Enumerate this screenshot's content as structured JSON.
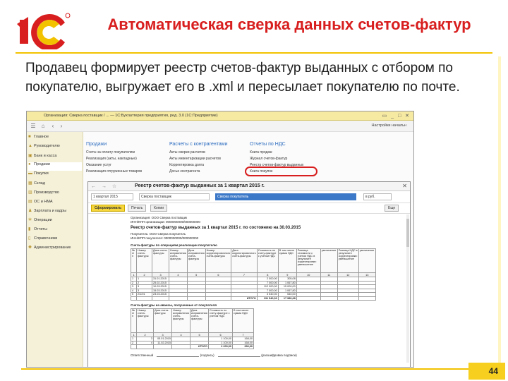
{
  "slide": {
    "title": "Автоматическая сверка данных счетов-фактур",
    "subtitle": "Продавец формирует реестр счетов-фактур выданных с отбором по покупателю, выгружает его в .xml и пересылает покупателю по почте.",
    "page_number": "44",
    "logo_text": "1С",
    "colors": {
      "accent": "#d81e1e",
      "brand_yellow": "#f2c200"
    }
  },
  "app": {
    "window_title": "Организация: Сверка поставщик / ... — 1С:Бухгалтерия предприятия, ред. 3.0 (1С:Предприятие)",
    "toolbar_right": "Настройки начальн",
    "sidebar": [
      {
        "label": "Главное",
        "icon": "home-icon"
      },
      {
        "label": "Руководителю",
        "icon": "chart-icon"
      },
      {
        "label": "Банк и касса",
        "icon": "bank-icon"
      },
      {
        "label": "Продажи",
        "icon": "cart-icon"
      },
      {
        "label": "Покупки",
        "icon": "basket-icon"
      },
      {
        "label": "Склад",
        "icon": "box-icon"
      },
      {
        "label": "Производство",
        "icon": "factory-icon"
      },
      {
        "label": "ОС и НМА",
        "icon": "building-icon"
      },
      {
        "label": "Зарплата и кадры",
        "icon": "people-icon"
      },
      {
        "label": "Операции",
        "icon": "gear-icon"
      },
      {
        "label": "Отчеты",
        "icon": "report-icon"
      },
      {
        "label": "Справочники",
        "icon": "book-icon"
      },
      {
        "label": "Администрирование",
        "icon": "settings-icon"
      }
    ],
    "sections": [
      {
        "head": "Продажи",
        "links": [
          "Счета на оплату покупателям",
          "Реализация (акты, накладные)",
          "Оказание услуг",
          "Реализация отгруженных товаров"
        ]
      },
      {
        "head": "Расчеты с контрагентами",
        "links": [
          "Акты сверки расчетов",
          "Акты инвентаризации расчетов",
          "Корректировка долга",
          "Досье контрагента"
        ]
      },
      {
        "head": "Отчеты по НДС",
        "links": [
          "Книга продаж",
          "Журнал счетов-фактур",
          "Реестр счетов-фактур выданных",
          "Книга покупок"
        ]
      }
    ]
  },
  "document": {
    "title": "Реестр счетов-фактур выданных за 1 квартал 2015 г.",
    "params": {
      "period": "1 квартал 2015",
      "organization": "Сверка поставщик",
      "counterparty": "Сверка покупатель",
      "currency": "в руб."
    },
    "buttons": {
      "generate": "Сформировать",
      "print": "Печать",
      "copy": "Копии",
      "more": "Еще"
    },
    "org_line": "Организация: ООО Сверка поставщик",
    "inn_line": "ИНН/КПП организации: 0000000000/000000000",
    "report_title": "Реестр счетов-фактур выданных за 1 квартал 2015 г. по состоянию на 30.03.2015",
    "buyer_line": "Покупатель: ООО Сверка покупатель",
    "buyer_inn_line": "ИНН/КПП покупателя: 0000000000/000000000",
    "sales_section": "Счета-фактуры по операциям реализации покупателю",
    "sales_headers": [
      "№ п/п",
      "Номер счета-фактуры",
      "Дата счета-фактуры",
      "Номер исправления счета-фактуры",
      "Дата исправления счета-фактуры",
      "Номер корректировочного счета-фактуры",
      "Дата корректировочного счета-фактуры",
      "Стоимость по счету-фактуре с учетом НДС",
      "В том числе сумма НДС",
      "Разница стоимости с учетом НДС в результате корректировки: уменьшение",
      "увеличение",
      "Разница НДС в результате корректировки: уменьшение",
      "увеличение"
    ],
    "sales_index": [
      "1",
      "2",
      "3",
      "4",
      "5",
      "6",
      "7",
      "8",
      "9",
      "10",
      "11",
      "12",
      "13"
    ],
    "sales_rows": [
      [
        "1",
        "1",
        "31.01.2015",
        "",
        "",
        "",
        "",
        "2 000,00",
        "305,08",
        "",
        "",
        "",
        ""
      ],
      [
        "2",
        "2",
        "25.02.2015",
        "",
        "",
        "",
        "",
        "7 000,00",
        "1 067,80",
        "",
        "",
        "",
        ""
      ],
      [
        "3",
        "3",
        "10.03.2015",
        "",
        "",
        "",
        "",
        "112 000,00",
        "15 000,00",
        "",
        "",
        "",
        ""
      ],
      [
        "4",
        "3",
        "15.03.2015",
        "",
        "",
        "",
        "",
        "7 000,00",
        "1 067,80",
        "",
        "",
        "",
        ""
      ],
      [
        "5",
        "2/1/01",
        "23.03.2015",
        "",
        "",
        "",
        "",
        "3 540,00",
        "540,00",
        "",
        "",
        "",
        ""
      ]
    ],
    "sales_total": [
      "",
      "",
      "",
      "",
      "",
      "",
      "ИТОГО",
      "131 540,00",
      "17 980,68",
      "",
      "",
      "",
      ""
    ],
    "advance_section": "Счета-фактуры на авансы, полученные от покупателя",
    "advance_headers": [
      "№ п/п",
      "Номер счета-фактуры",
      "Дата счета-фактуры",
      "Номер исправления счета-фактуры",
      "Дата исправления счета-фактуры",
      "Стоимость по счету-фактуре с учетом НДС",
      "В том числе сумма НДС"
    ],
    "advance_index": [
      "1",
      "2",
      "3",
      "4",
      "5",
      "6",
      "7"
    ],
    "advance_rows": [
      [
        "1",
        "3",
        "05.01.2015",
        "",
        "",
        "1 100,00",
        "168,00"
      ],
      [
        "2",
        "4",
        "11.02.2015",
        "",
        "",
        "1 100,00",
        "168,00"
      ]
    ],
    "advance_total": [
      "",
      "",
      "",
      "",
      "ИТОГО",
      "2 200,00",
      "336,00"
    ],
    "responsible": "Ответственный",
    "sign_caption": "(подпись)",
    "decode_caption": "(расшифровка подписи)"
  }
}
